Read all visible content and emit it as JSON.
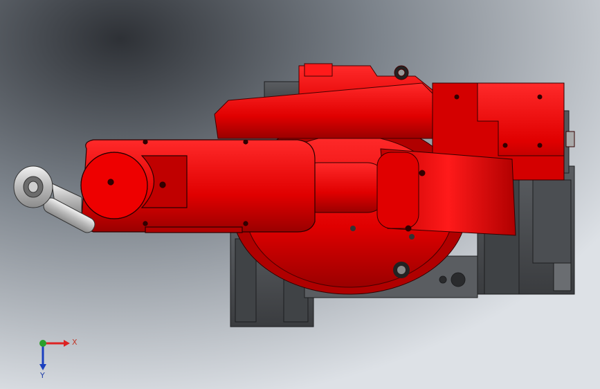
{
  "viewport": {
    "background_colors": [
      "#2f3338",
      "#9aa0a7",
      "#dfe3e8"
    ],
    "robot_color": "#e00000",
    "robot_dark": "#8a0000",
    "base_color": "#4a4d50",
    "tool_color": "#d7d7d7"
  },
  "triad": {
    "x_label": "X",
    "y_label": "Y",
    "x_color": "#d22",
    "y_color": "#1a3fbf",
    "origin_color": "#2b9f2b",
    "x_icon": "x-axis-arrow-icon",
    "y_icon": "y-axis-arrow-icon"
  }
}
